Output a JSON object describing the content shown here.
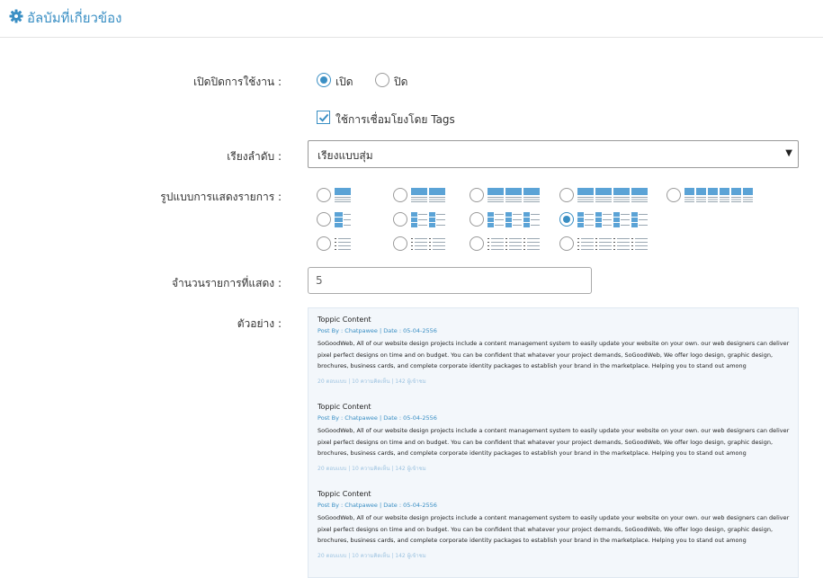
{
  "header": {
    "title": "อัลบัมที่เกี่ยวข้อง",
    "icon": "gear-icon"
  },
  "form": {
    "enable_label": "เปิดปิดการใช้งาน :",
    "enable_on": "เปิด",
    "enable_off": "ปิด",
    "enable_selected": "on",
    "tags_label": "ใช้การเชื่อมโยงโดย Tags",
    "tags_checked": true,
    "order_label": "เรียงลำดับ :",
    "order_value": "เรียงแบบสุ่ม",
    "layout_label": "รูปแบบการแสดงรายการ :",
    "layout_selected": 8,
    "count_label": "จำนวนรายการที่แสดง :",
    "count_value": "5",
    "preview_label": "ตัวอย่าง :"
  },
  "colors": {
    "accent": "#3a8fc4",
    "block": "#5ba3d6",
    "line": "#9aa7b2"
  },
  "preview": {
    "posts": [
      {
        "title": "Toppic Content",
        "meta": "Post By : Chatpawee  |  Date : 05-04-2556",
        "body": "SoGoodWeb, All of our website design projects include a content management system to easily update your website on your own. our web designers can deliver pixel perfect designs on time and on budget. You can be confident that whatever your project demands, SoGoodWeb, We offer logo design, graphic design, brochures, business cards, and complete corporate identity packages to establish your brand in the marketplace. Helping you to stand out among",
        "stats": "20 ตอบแบบ | 10 ความคิดเห็น | 142 ผู้เข้าชม"
      },
      {
        "title": "Toppic Content",
        "meta": "Post By : Chatpawee  |  Date : 05-04-2556",
        "body": "SoGoodWeb, All of our website design projects include a content management system to easily update your website on your own. our web designers can deliver pixel perfect designs on time and on budget. You can be confident that whatever your project demands, SoGoodWeb, We offer logo design, graphic design, brochures, business cards, and complete corporate identity packages to establish your brand in the marketplace. Helping you to stand out among",
        "stats": "20 ตอบแบบ | 10 ความคิดเห็น | 142 ผู้เข้าชม"
      },
      {
        "title": "Toppic Content",
        "meta": "Post By : Chatpawee  |  Date : 05-04-2556",
        "body": "SoGoodWeb, All of our website design projects include a content management system to easily update your website on your own. our web designers can deliver pixel perfect designs on time and on budget. You can be confident that whatever your project demands, SoGoodWeb, We offer logo design, graphic design, brochures, business cards, and complete corporate identity packages to establish your brand in the marketplace. Helping you to stand out among",
        "stats": "20 ตอบแบบ | 10 ความคิดเห็น | 142 ผู้เข้าชม"
      }
    ]
  }
}
